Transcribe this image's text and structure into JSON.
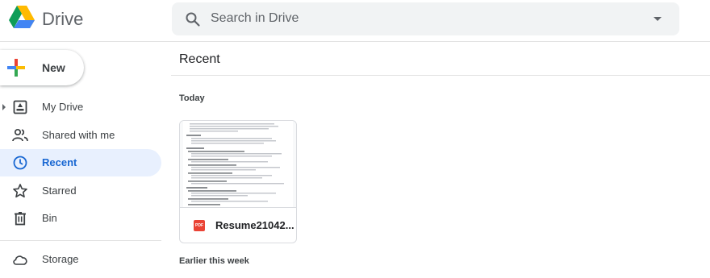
{
  "header": {
    "brand": "Drive",
    "search_placeholder": "Search in Drive"
  },
  "sidebar": {
    "new_label": "New",
    "items": [
      {
        "label": "My Drive"
      },
      {
        "label": "Shared with me"
      },
      {
        "label": "Recent"
      },
      {
        "label": "Starred"
      },
      {
        "label": "Bin"
      },
      {
        "label": "Storage"
      }
    ],
    "active_item": "Recent"
  },
  "main": {
    "title": "Recent",
    "sections": [
      {
        "heading": "Today"
      },
      {
        "heading": "Earlier this week"
      }
    ],
    "files": [
      {
        "name": "Resume21042...",
        "type_badge": "PDF"
      }
    ]
  },
  "colors": {
    "accent": "#1967d2",
    "active_bg": "#e8f0fe",
    "pdf_red": "#ea4335"
  }
}
